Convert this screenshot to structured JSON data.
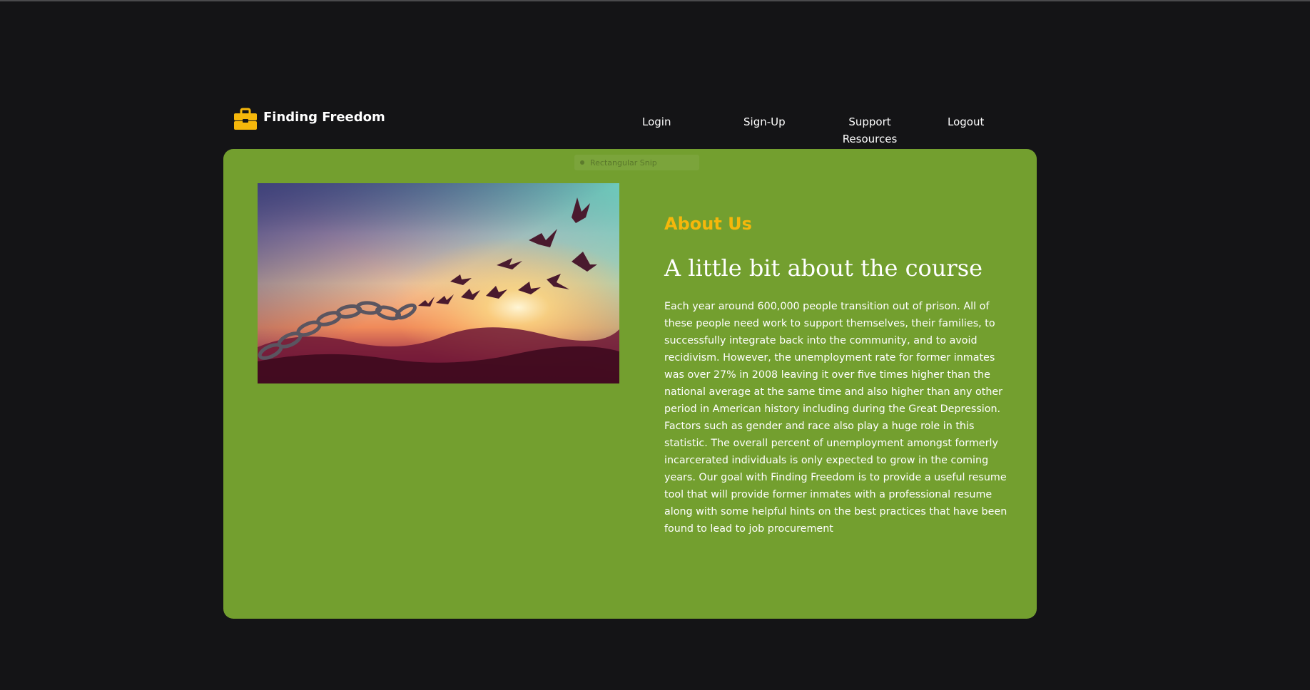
{
  "brand": {
    "name": "Finding Freedom",
    "icon": "briefcase-icon",
    "icon_color": "#f5b70b"
  },
  "nav": {
    "login": "Login",
    "signup": "Sign-Up",
    "support": "Support Resources",
    "logout": "Logout"
  },
  "overlay": {
    "label": "Rectangular Snip"
  },
  "hero": {
    "image_alt": "Broken chain turning into birds flying toward a sunset"
  },
  "about": {
    "kicker": "About Us",
    "title": "A little bit about the course",
    "body": "Each year around 600,000 people transition out of prison. All of these people need work to support themselves, their families, to successfully integrate back into the community, and to avoid recidivism. However, the unemployment rate for former inmates was over 27% in 2008 leaving it over five times higher than the national average at the same time and also higher than any other period in American history including during the Great Depression. Factors such as gender and race also play a huge role in this statistic. The overall percent of unemployment amongst formerly incarcerated individuals is only expected to grow in the coming years. Our goal with Finding Freedom is to provide a useful resume tool that will provide former inmates with a professional resume along with some helpful hints on the best practices that have been found to lead to job procurement"
  },
  "colors": {
    "background": "#141416",
    "panel": "#739f2f",
    "accent": "#f5b70b",
    "text": "#ffffff"
  }
}
